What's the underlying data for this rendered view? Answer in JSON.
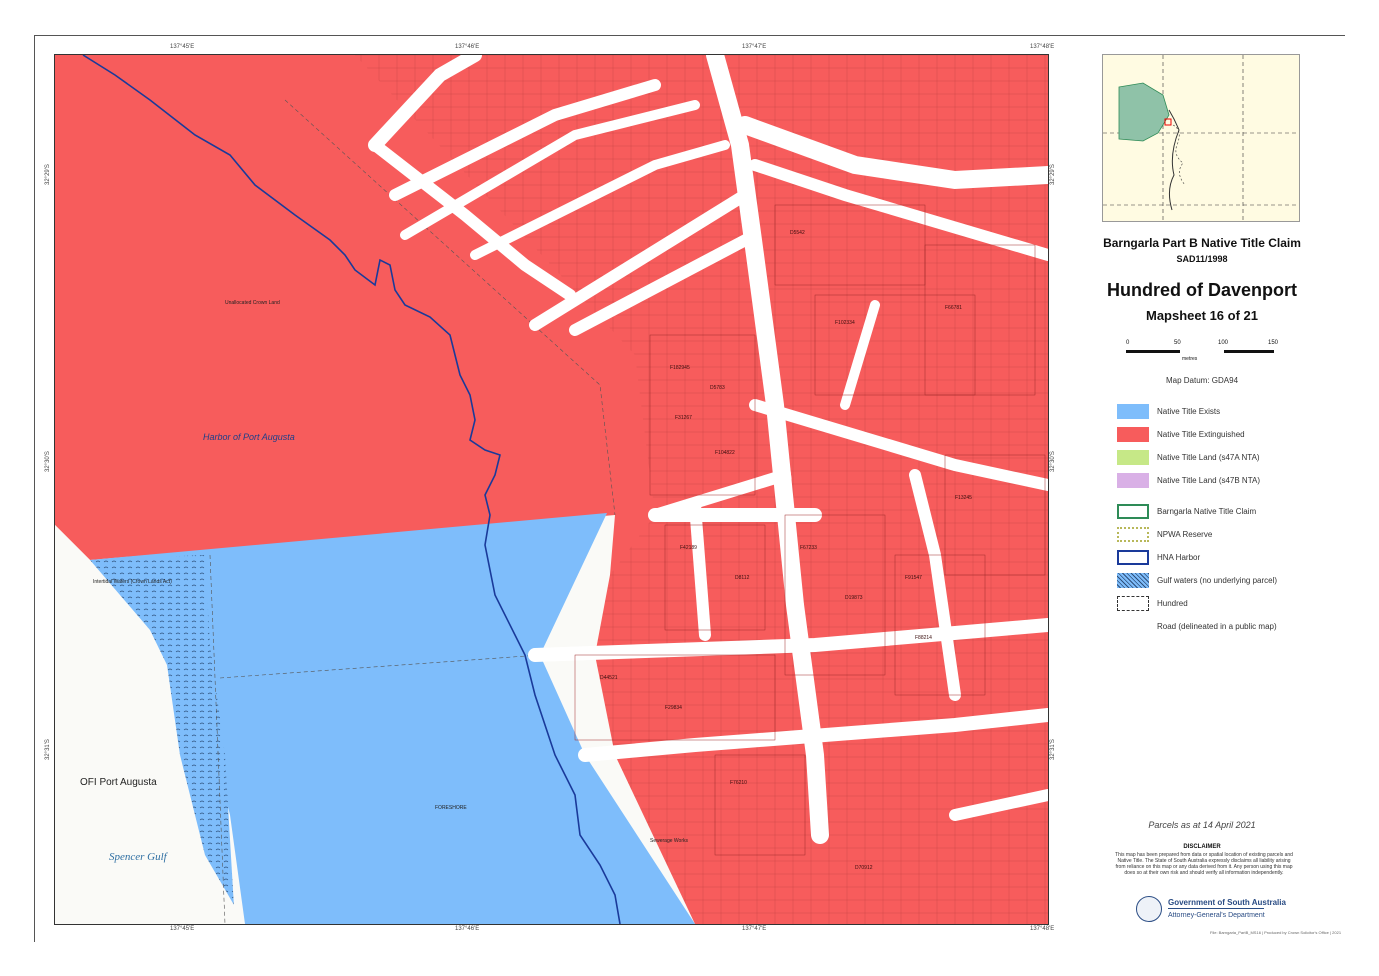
{
  "map": {
    "top_ticks": [
      "137°45'E",
      "137°46'E",
      "137°47'E",
      "137°48'E"
    ],
    "bottom_ticks": [
      "137°45'E",
      "137°46'E",
      "137°47'E",
      "137°48'E"
    ],
    "left_ticks": [
      "32°29'S",
      "32°30'S",
      "32°31'S"
    ],
    "right_ticks": [
      "32°29'S",
      "32°30'S",
      "32°31'S"
    ],
    "labels": {
      "harbor": "Harbor of Port Augusta",
      "ofi": "OFI Port Augusta",
      "spencer": "Spencer Gulf",
      "unalloc": "Unallocated Crown Land",
      "tidal": "Intertidal Waters (Crown Lands Act)",
      "fw": "FORESHORE",
      "sewerage": "Sewerage Works"
    },
    "parcel_ids": [
      "F182945",
      "D5783",
      "F31267",
      "F104822",
      "F42189",
      "D8112",
      "F67233",
      "D19873",
      "F91547",
      "F88214",
      "D44521",
      "F29834",
      "F76210",
      "D5542",
      "F102334",
      "F66781",
      "F13245",
      "D70912"
    ],
    "colors": {
      "extinguished": "#f75c5c",
      "exists": "#7ebdfb",
      "road": "#ffffff",
      "river": "#1a3a9a"
    }
  },
  "panel": {
    "claim_title": "Barngarla Part B Native Title Claim",
    "claim_no": "SAD11/1998",
    "hundred": "Hundred of Davenport",
    "mapsheet": "Mapsheet 16 of 21",
    "scale_left": [
      "0",
      "50"
    ],
    "scale_right": [
      "100",
      "150"
    ],
    "scale_unit": "metres",
    "datum": "Map Datum: GDA94",
    "legend": [
      {
        "label": "Native Title Exists",
        "color": "#7ebdfb",
        "style": "fill"
      },
      {
        "label": "Native Title Extinguished",
        "color": "#f75c5c",
        "style": "fill"
      },
      {
        "label": "Native Title Land (s47A NTA)",
        "color": "#c6e887",
        "style": "fill"
      },
      {
        "label": "Native Title Land (s47B NTA)",
        "color": "#d9b0e6",
        "style": "fill"
      },
      {
        "label": "Barngarla Native Title Claim",
        "color": "#2e8b57",
        "style": "outline"
      },
      {
        "label": "NPWA Reserve",
        "color": "#b8b85a",
        "style": "hatch"
      },
      {
        "label": "HNA Harbor",
        "color": "#1a3a9a",
        "style": "outline"
      },
      {
        "label": "Gulf waters (no underlying parcel)",
        "color": "#7ebdfb",
        "style": "dots"
      },
      {
        "label": "Hundred",
        "color": "#333333",
        "style": "dashed"
      },
      {
        "label": "Road (delineated in a public map)",
        "color": "#ffffff",
        "style": "none"
      }
    ],
    "parcels_note": "Parcels as at 14 April 2021",
    "disclaimer_head": "DISCLAIMER",
    "disclaimer": "This map has been prepared from data or spatial location of existing parcels and Native Title. The State of South Australia expressly disclaims all liability arising from reliance on this map or any data derived from it. Any person using this map does so at their own risk and should verify all information independently.",
    "gov_name": "Government of South Australia",
    "gov_dept": "Attorney-General's Department",
    "footer": "File: Barngarla_PartB_MS16 | Produced by Crown Solicitor's Office | 2021"
  }
}
